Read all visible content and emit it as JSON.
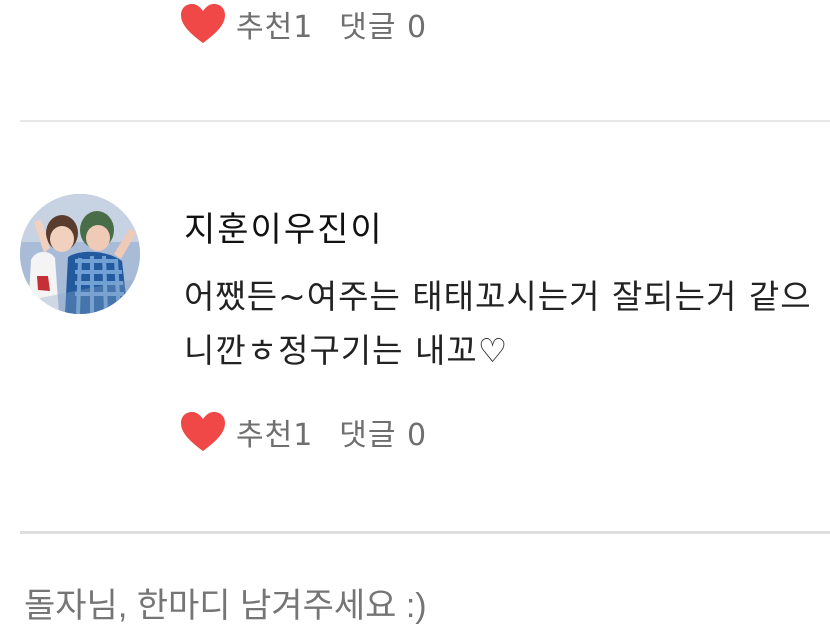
{
  "previous_comment": {
    "like_label": "추천1",
    "reply_label": "댓글 0"
  },
  "comment": {
    "author": "지훈이우진이",
    "text": "어쨌든~여주는 태태꼬시는거 잘되는거 같으니깐ㅎ정구기는 내꼬♡",
    "like_label": "추천1",
    "reply_label": "댓글 0"
  },
  "comment_input": {
    "placeholder": "돌자님, 한마디 남겨주세요 :)"
  },
  "colors": {
    "heart": "#f04747",
    "meta_text": "#6f6f6f",
    "divider": "#e7e7e7",
    "placeholder": "#c9c9c9"
  },
  "icons": {
    "like": "heart-icon"
  }
}
